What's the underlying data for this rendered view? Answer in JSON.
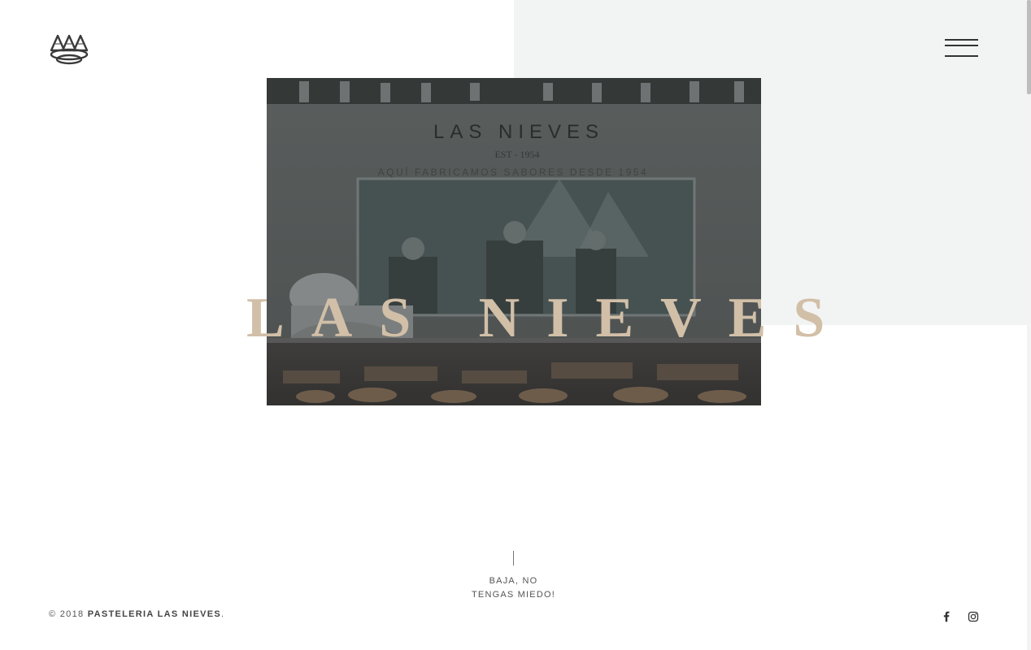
{
  "header": {
    "logo_icon": "three-mountains-logo-icon",
    "menu_icon": "hamburger-menu-icon"
  },
  "hero": {
    "title": "LAS NIEVES",
    "photo": {
      "sign_title": "LAS NIEVES",
      "sign_est": "EST - 1954",
      "sign_tagline": "AQUÍ FABRICAMOS SABORES DESDE 1954"
    }
  },
  "scroll_cue": {
    "line1": "BAJA, NO",
    "line2": "TENGAS MIEDO!"
  },
  "footer": {
    "copyright": "© 2018",
    "brand": "PASTELERIA LAS NIEVES",
    "suffix": ".",
    "social": [
      {
        "icon": "facebook-icon"
      },
      {
        "icon": "instagram-icon"
      }
    ]
  },
  "colors": {
    "title": "#d2bfa8",
    "panel": "#f2f4f3",
    "text": "#555555"
  }
}
